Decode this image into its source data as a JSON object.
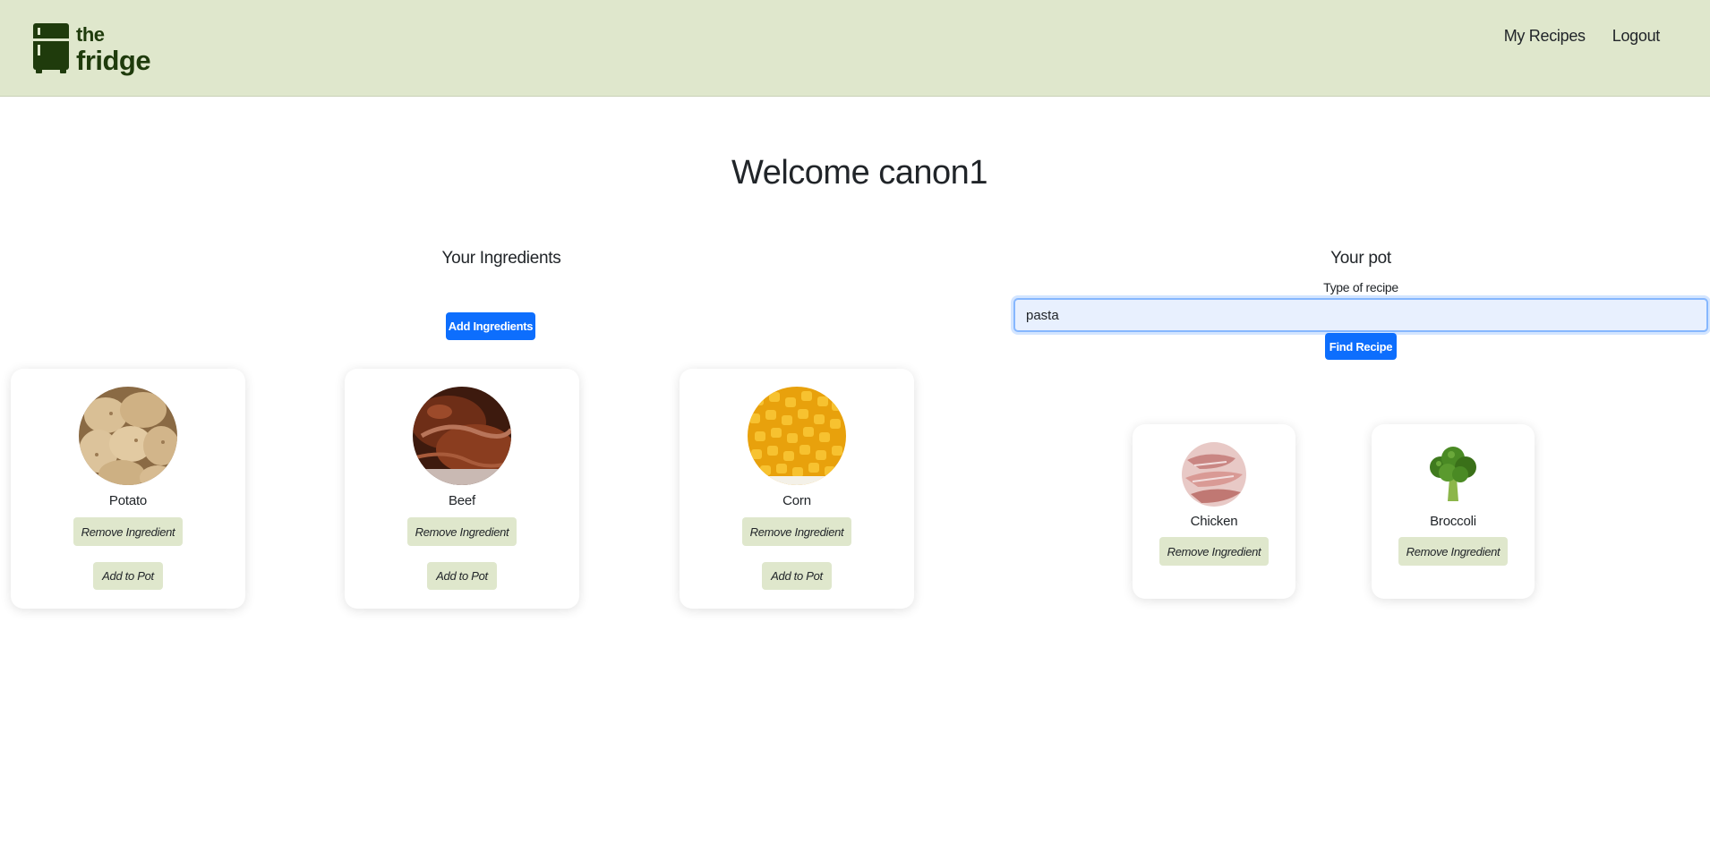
{
  "header": {
    "logo_line1": "the",
    "logo_line2": "fridge",
    "nav": [
      "My Recipes",
      "Logout"
    ]
  },
  "welcome": "Welcome canon1",
  "ingredients": {
    "title": "Your Ingredients",
    "add_button": "Add Ingredients",
    "items": [
      {
        "name": "Potato",
        "remove_label": "Remove Ingredient",
        "add_label": "Add to Pot",
        "image": "potato-image"
      },
      {
        "name": "Beef",
        "remove_label": "Remove Ingredient",
        "add_label": "Add to Pot",
        "image": "beef-image"
      },
      {
        "name": "Corn",
        "remove_label": "Remove Ingredient",
        "add_label": "Add to Pot",
        "image": "corn-image"
      }
    ]
  },
  "pot": {
    "title": "Your pot",
    "type_label": "Type of recipe",
    "type_value": "pasta",
    "find_button": "Find Recipe",
    "items": [
      {
        "name": "Chicken",
        "remove_label": "Remove Ingredient",
        "image": "chicken-image"
      },
      {
        "name": "Broccoli",
        "remove_label": "Remove Ingredient",
        "image": "broccoli-image"
      }
    ]
  },
  "colors": {
    "header_bg": "#dfe7cc",
    "logo_green": "#1f3b0c",
    "primary_blue": "#0d6efd",
    "soft_button": "#dfe7cc"
  }
}
